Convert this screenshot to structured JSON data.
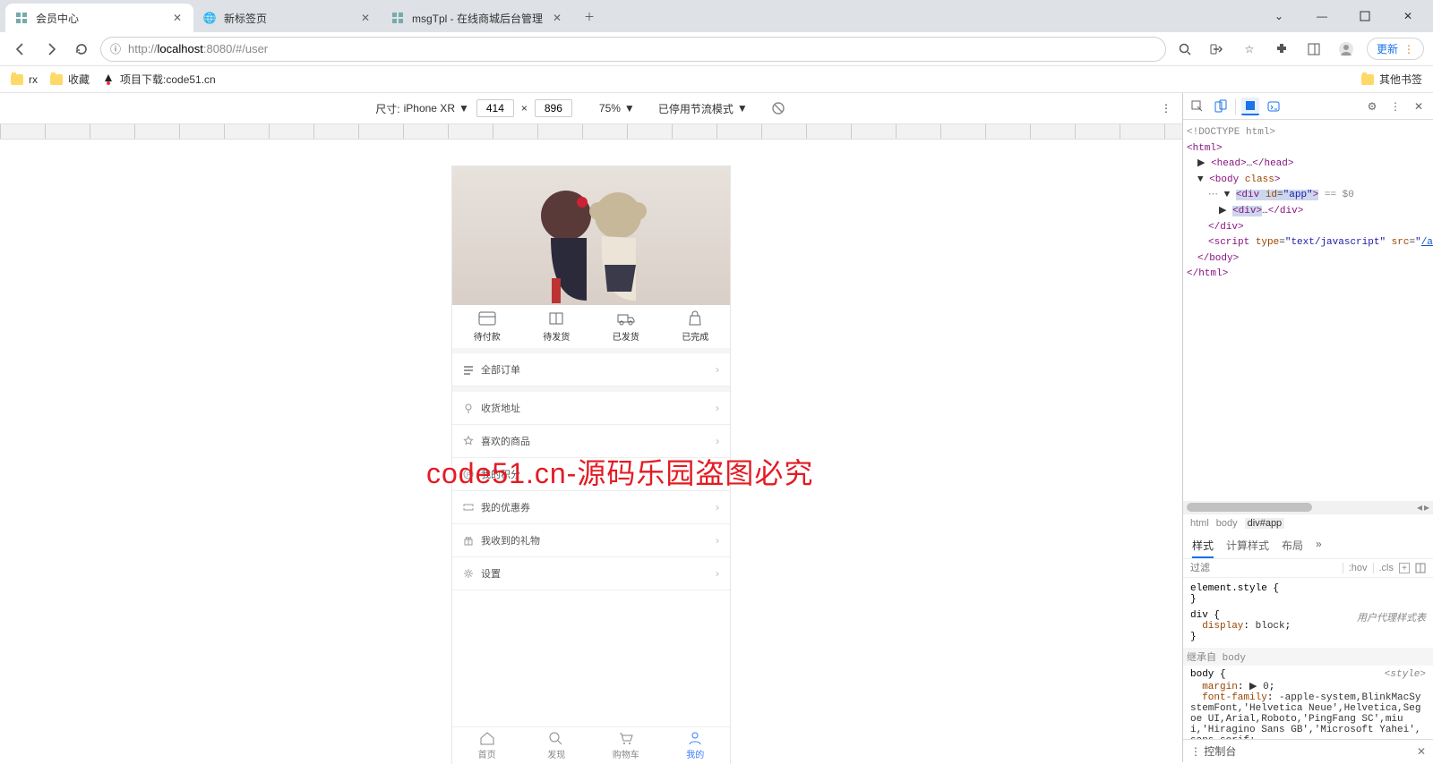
{
  "browser": {
    "tabs": [
      {
        "title": "会员中心",
        "active": true
      },
      {
        "title": "新标签页",
        "active": false
      },
      {
        "title": "msgTpl - 在线商城后台管理",
        "active": false
      }
    ],
    "url_prefix": "http://",
    "url_host": "localhost",
    "url_rest": ":8080/#/user",
    "update_label": "更新",
    "bookmarks": [
      {
        "label": "rx",
        "type": "folder"
      },
      {
        "label": "收藏",
        "type": "folder"
      },
      {
        "label": "项目下载:code51.cn",
        "type": "link"
      }
    ],
    "other_bookmarks": "其他书签"
  },
  "device_toolbar": {
    "dim_label": "尺寸:",
    "device": "iPhone XR",
    "width": "414",
    "height": "896",
    "zoom": "75%",
    "throttle": "已停用节流模式"
  },
  "phone": {
    "status_items": [
      {
        "label": "待付款"
      },
      {
        "label": "待发货"
      },
      {
        "label": "已发货"
      },
      {
        "label": "已完成"
      }
    ],
    "menu1": [
      {
        "label": "全部订单"
      }
    ],
    "menu2": [
      {
        "label": "收货地址"
      },
      {
        "label": "喜欢的商品"
      },
      {
        "label": "我的积分"
      },
      {
        "label": "我的优惠券"
      },
      {
        "label": "我收到的礼物"
      },
      {
        "label": "设置"
      }
    ],
    "tabbar": [
      {
        "label": "首页",
        "active": false
      },
      {
        "label": "发现",
        "active": false
      },
      {
        "label": "购物车",
        "active": false
      },
      {
        "label": "我的",
        "active": true
      }
    ]
  },
  "watermark": "code51.cn-源码乐园盗图必究",
  "devtools": {
    "dom_lines": [
      {
        "pad": 0,
        "html": "<!DOCTYPE html>"
      },
      {
        "pad": 0,
        "html": "<html>"
      },
      {
        "pad": 1,
        "html": "▶ <head>…</head>",
        "expandable": true
      },
      {
        "pad": 1,
        "html": "▼ <body class>"
      },
      {
        "pad": 2,
        "html": "▼ <div id=\"app\"> == $0",
        "selected": true
      },
      {
        "pad": 3,
        "html": "▶ <div>…</div>",
        "expandable": true
      },
      {
        "pad": 2,
        "html": "</div>"
      },
      {
        "pad": 2,
        "html": "<script type=\"text/javascript\" src=\"/app.js\"></scr ipt>"
      },
      {
        "pad": 1,
        "html": "</body>"
      },
      {
        "pad": 0,
        "html": "</html>"
      }
    ],
    "crumbs": [
      "html",
      "body",
      "div#app"
    ],
    "style_tabs": [
      "样式",
      "计算样式",
      "布局"
    ],
    "filter_placeholder": "过滤",
    "hov": ":hov",
    "cls": ".cls",
    "element_style": "element.style {",
    "brace_close": "}",
    "div_sel": "div {",
    "div_src": "用户代理样式表",
    "display_prop": "display",
    "display_val": "block",
    "inherits_body": "继承自 body",
    "body_sel": "body {",
    "body_src": "<style>",
    "margin_prop": "margin",
    "margin_val": "▶ 0",
    "ff_prop": "font-family",
    "ff_val": "-apple-system,BlinkMacSystemFont,'Helvetica Neue',Helvetica,Segoe UI,Arial,Roboto,'PingFang SC',miui,'Hiragino Sans GB','Microsoft Yahei',sans-serif;",
    "drawer_label": "控制台"
  }
}
